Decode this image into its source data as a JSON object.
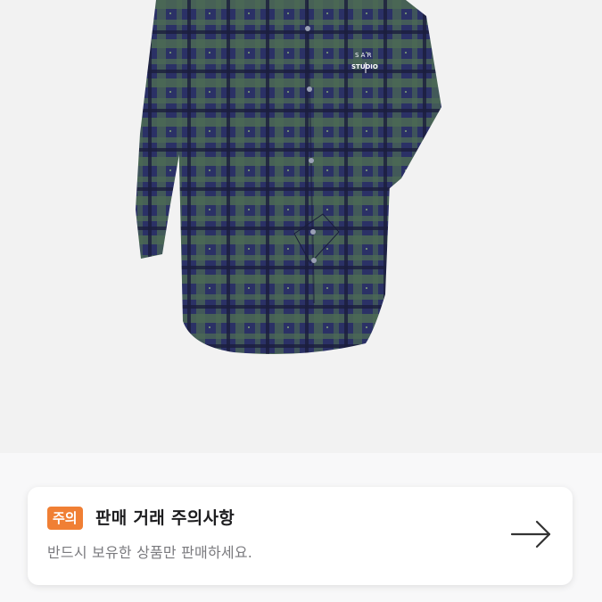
{
  "product": {
    "image_alt": "plaid shirt",
    "logo_text_top": "S A R",
    "logo_text_bottom": "STUDIO",
    "colors": {
      "navy": "#23295a",
      "green": "#4e6b55",
      "background": "#f2f2f2"
    }
  },
  "notice": {
    "badge": "주의",
    "title": "판매 거래 주의사항",
    "description": "반드시 보유한 상품만 판매하세요.",
    "arrow_icon": "arrow-right-icon",
    "accent_color": "#f07f34"
  }
}
